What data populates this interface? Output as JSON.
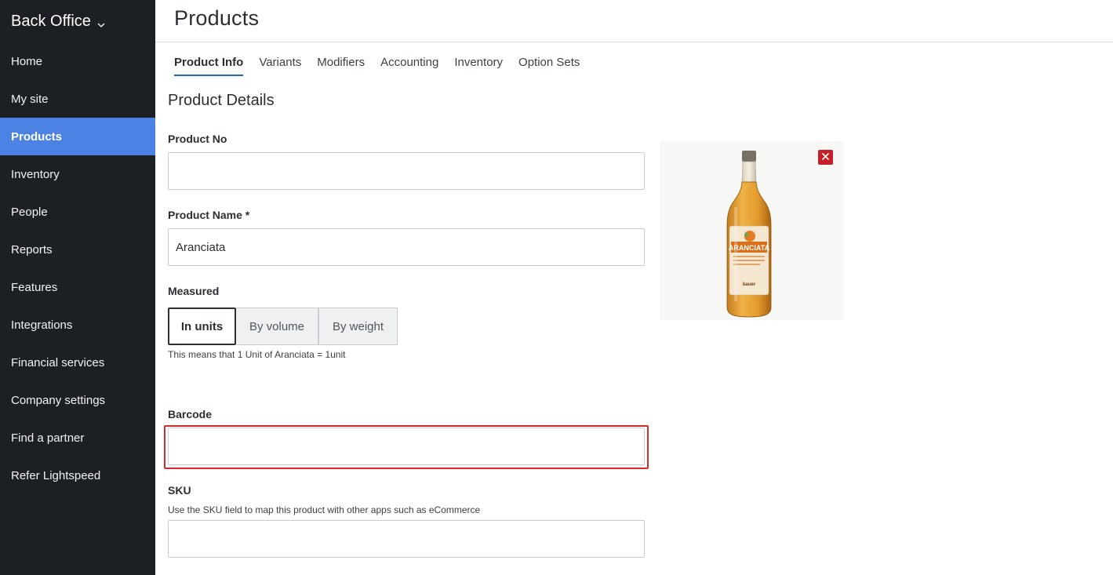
{
  "sidebar": {
    "brand": "Back Office",
    "items": [
      {
        "label": "Home",
        "active": false
      },
      {
        "label": "My site",
        "active": false
      },
      {
        "label": "Products",
        "active": true
      },
      {
        "label": "Inventory",
        "active": false
      },
      {
        "label": "People",
        "active": false
      },
      {
        "label": "Reports",
        "active": false
      },
      {
        "label": "Features",
        "active": false
      },
      {
        "label": "Integrations",
        "active": false
      },
      {
        "label": "Financial services",
        "active": false
      },
      {
        "label": "Company settings",
        "active": false
      },
      {
        "label": "Find a partner",
        "active": false
      },
      {
        "label": "Refer Lightspeed",
        "active": false
      }
    ]
  },
  "header": {
    "title": "Products"
  },
  "tabs": [
    {
      "label": "Product Info",
      "active": true
    },
    {
      "label": "Variants",
      "active": false
    },
    {
      "label": "Modifiers",
      "active": false
    },
    {
      "label": "Accounting",
      "active": false
    },
    {
      "label": "Inventory",
      "active": false
    },
    {
      "label": "Option Sets",
      "active": false
    }
  ],
  "form": {
    "section_title": "Product Details",
    "product_no": {
      "label": "Product No",
      "value": ""
    },
    "product_name": {
      "label": "Product Name *",
      "value": "Aranciata"
    },
    "measured": {
      "label": "Measured",
      "options": [
        "In units",
        "By volume",
        "By weight"
      ],
      "selected": "In units",
      "helper": "This means that 1 Unit of Aranciata = 1unit"
    },
    "barcode": {
      "label": "Barcode",
      "value": ""
    },
    "sku": {
      "label": "SKU",
      "helper": "Use the SKU field to map this product with other apps such as eCommerce",
      "value": ""
    }
  },
  "image": {
    "bottle_label": "ARANCIATA",
    "brand_mark": "bauer"
  },
  "colors": {
    "sidebar_bg": "#1c1f23",
    "active_nav": "#4b82e3",
    "tab_underline": "#2a5fc4",
    "highlight": "#d42c2c",
    "remove_button": "#c5202a"
  },
  "icons": [
    "chevron-down-icon",
    "close-icon"
  ]
}
